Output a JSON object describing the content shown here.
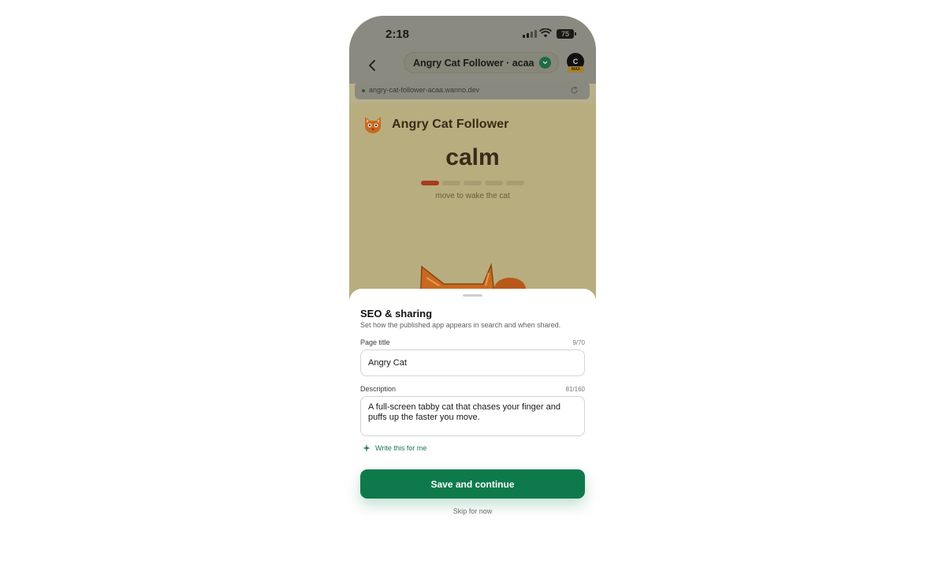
{
  "status": {
    "time": "2:18",
    "battery": "75"
  },
  "nav": {
    "title": "Angry Cat Follower · acaa",
    "avatar_initial": "C",
    "avatar_badge": "MAX"
  },
  "browser": {
    "url": "angry-cat-follower-acaa.wanno.dev"
  },
  "app": {
    "title": "Angry Cat Follower",
    "mood": "calm",
    "mood_level": 1,
    "mood_levels_total": 5,
    "hint": "move to wake the cat"
  },
  "sheet": {
    "title": "SEO & sharing",
    "subtitle": "Set how the published app appears in search and when shared.",
    "page_title_label": "Page title",
    "page_title_counter": "9/70",
    "page_title_value": "Angry Cat",
    "description_label": "Description",
    "description_counter": "81/160",
    "description_value": "A full-screen tabby cat that chases your finger and puffs up the faster you move.",
    "write_label": "Write this for me",
    "save_label": "Save and continue",
    "skip_label": "Skip for now"
  },
  "colors": {
    "accent": "#0e7a4b",
    "meter_active": "#a83a20"
  }
}
